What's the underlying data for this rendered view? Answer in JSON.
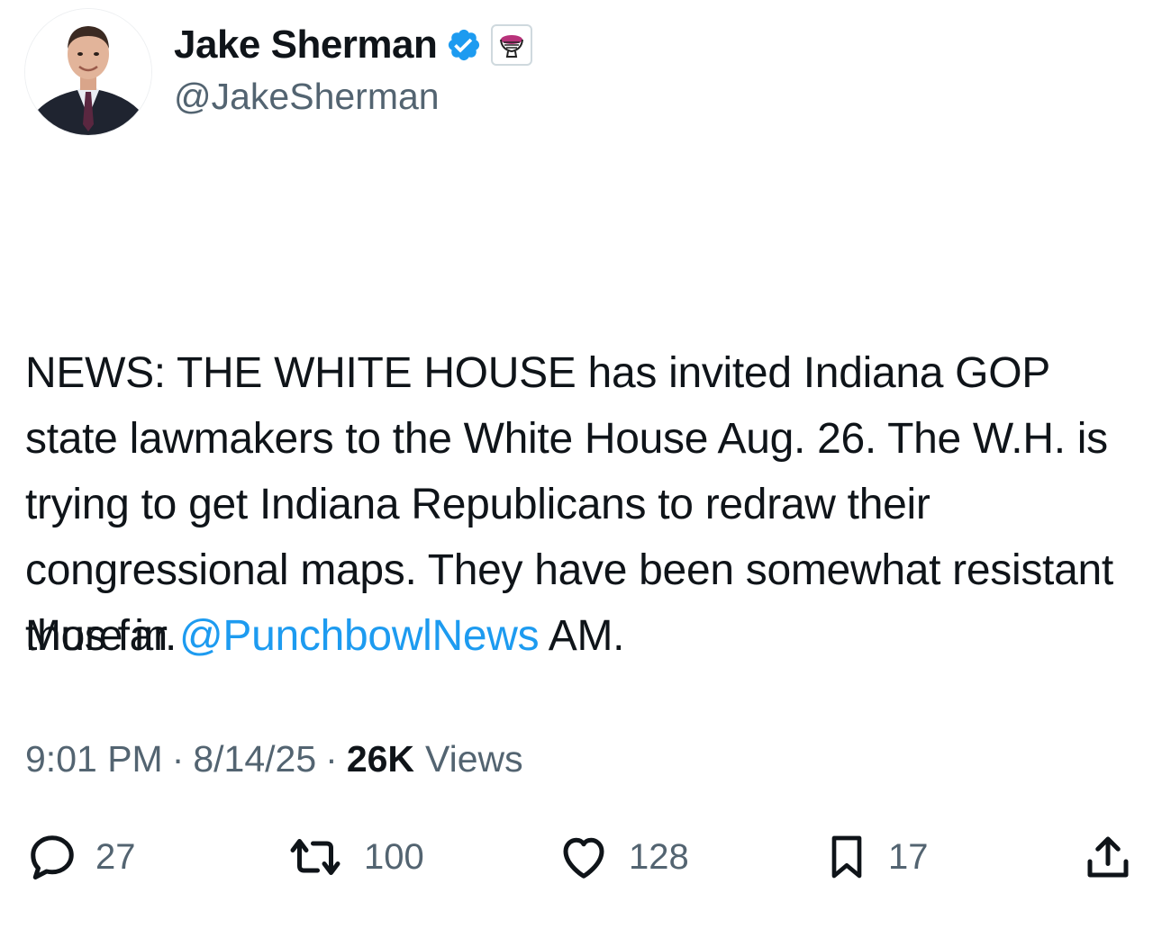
{
  "author": {
    "display_name": "Jake Sherman",
    "handle": "@JakeSherman",
    "verified_icon": "verified-badge-icon",
    "affiliate_icon": "punchbowl-affiliate-icon"
  },
  "tweet": {
    "paragraph_1": "NEWS: THE WHITE HOUSE has invited Indiana GOP state lawmakers to the White House Aug. 26. The W.H. is trying to get Indiana Republicans to redraw their congressional maps. They have been somewhat resistant thus far.",
    "more_prefix": "More in ",
    "mention": "@PunchbowlNews",
    "more_suffix": " AM."
  },
  "meta": {
    "time": "9:01 PM",
    "separator": "·",
    "date": "8/14/25",
    "views_count": "26K",
    "views_label": "Views"
  },
  "actions": {
    "replies": "27",
    "reposts": "100",
    "likes": "128",
    "bookmarks": "17"
  },
  "colors": {
    "text": "#0f1419",
    "secondary": "#536471",
    "link": "#1d9bf0",
    "verified": "#1d9bf0"
  }
}
